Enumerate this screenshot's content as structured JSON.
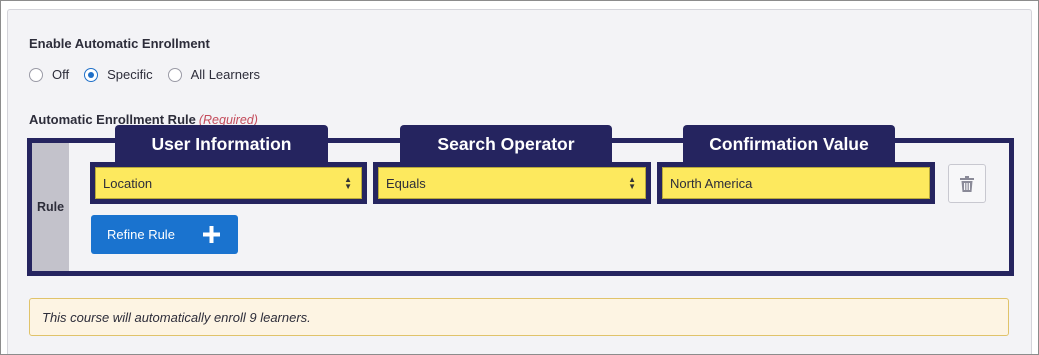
{
  "enrollment": {
    "title": "Enable Automatic Enrollment",
    "options": [
      {
        "label": "Off",
        "checked": false
      },
      {
        "label": "Specific",
        "checked": true
      },
      {
        "label": "All Learners",
        "checked": false
      }
    ]
  },
  "rule_section": {
    "title": "Automatic Enrollment Rule",
    "required": "(Required)",
    "side_label": "Rule",
    "headers": {
      "user_information": "User Information",
      "search_operator": "Search Operator",
      "confirmation_value": "Confirmation Value"
    },
    "user_information_value": "Location",
    "search_operator_value": "Equals",
    "confirmation_value": "North America",
    "refine_button": "Refine Rule"
  },
  "notice": "This course will automatically enroll 9 learners.",
  "colors": {
    "highlight_navy": "#25245f",
    "field_yellow": "#fde95e",
    "primary_blue": "#1a73cf",
    "notice_bg": "#fdf4e3"
  },
  "icons": [
    "radio-icon",
    "select-caret-icon",
    "trash-icon",
    "plus-icon"
  ]
}
